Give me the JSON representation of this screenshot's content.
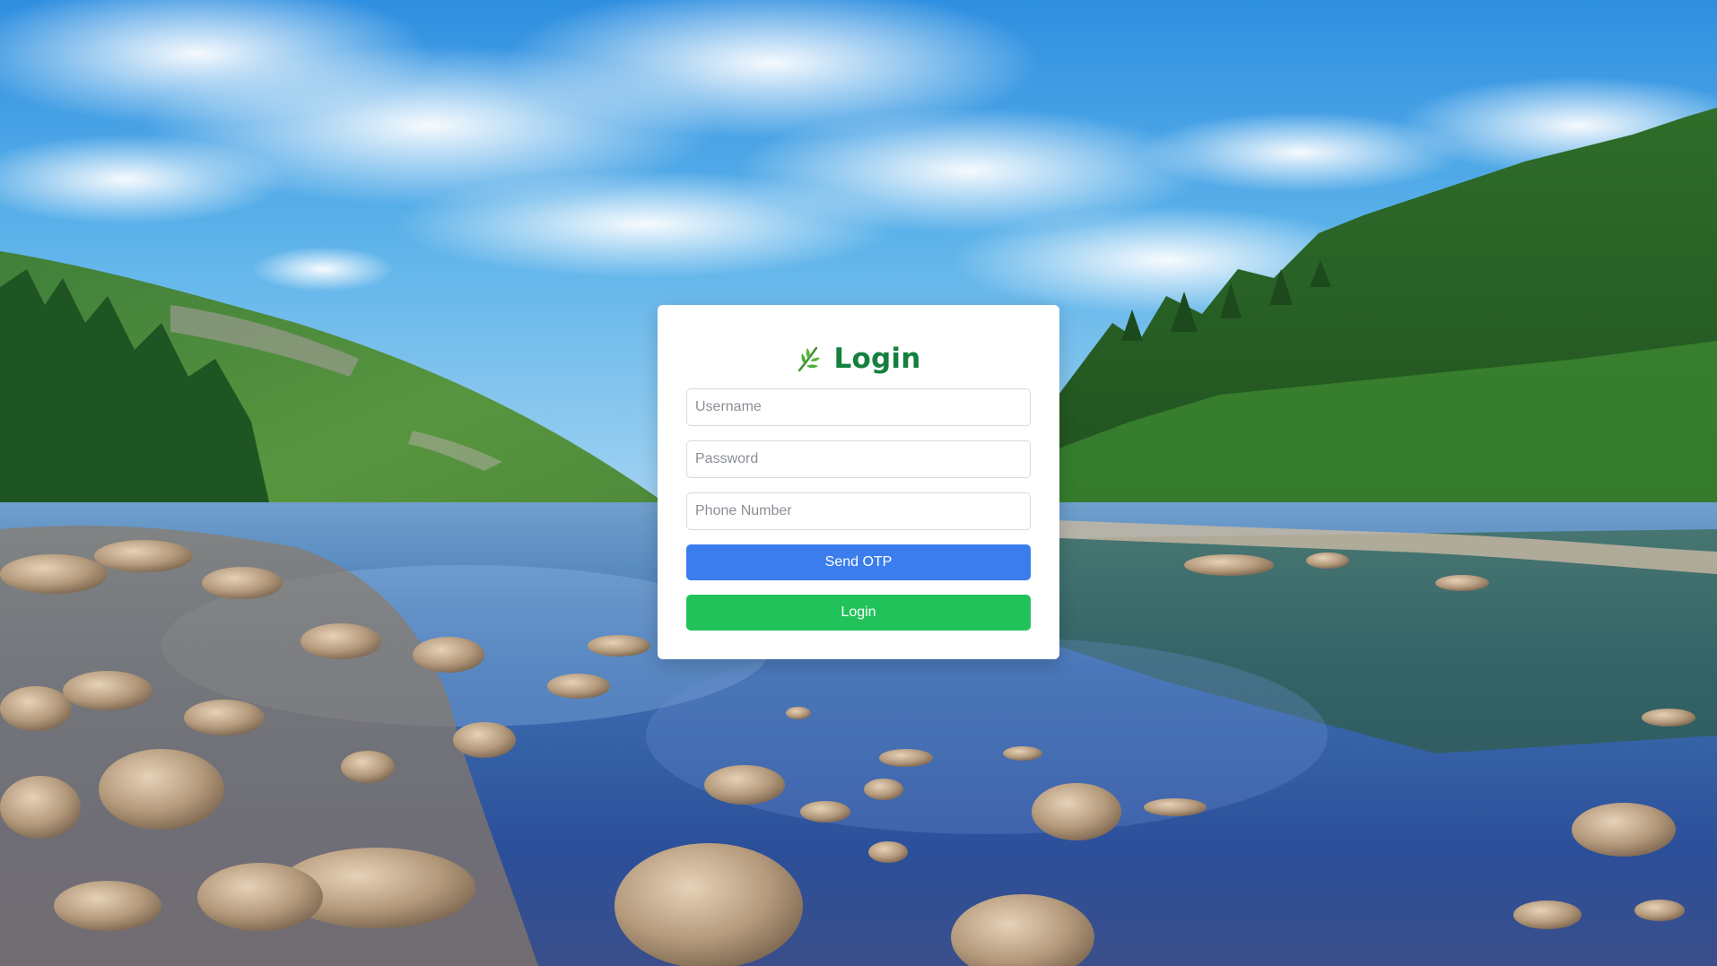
{
  "background": {
    "description_icon": "lake-landscape-photo"
  },
  "login_card": {
    "icon": "leaf-icon",
    "title": "Login",
    "username": {
      "placeholder": "Username",
      "value": ""
    },
    "password": {
      "placeholder": "Password",
      "value": ""
    },
    "phone": {
      "placeholder": "Phone Number",
      "value": ""
    },
    "send_otp_label": "Send OTP",
    "login_label": "Login"
  },
  "colors": {
    "title": "#15803d",
    "send_otp": "#3b7ded",
    "login": "#22c25a"
  }
}
